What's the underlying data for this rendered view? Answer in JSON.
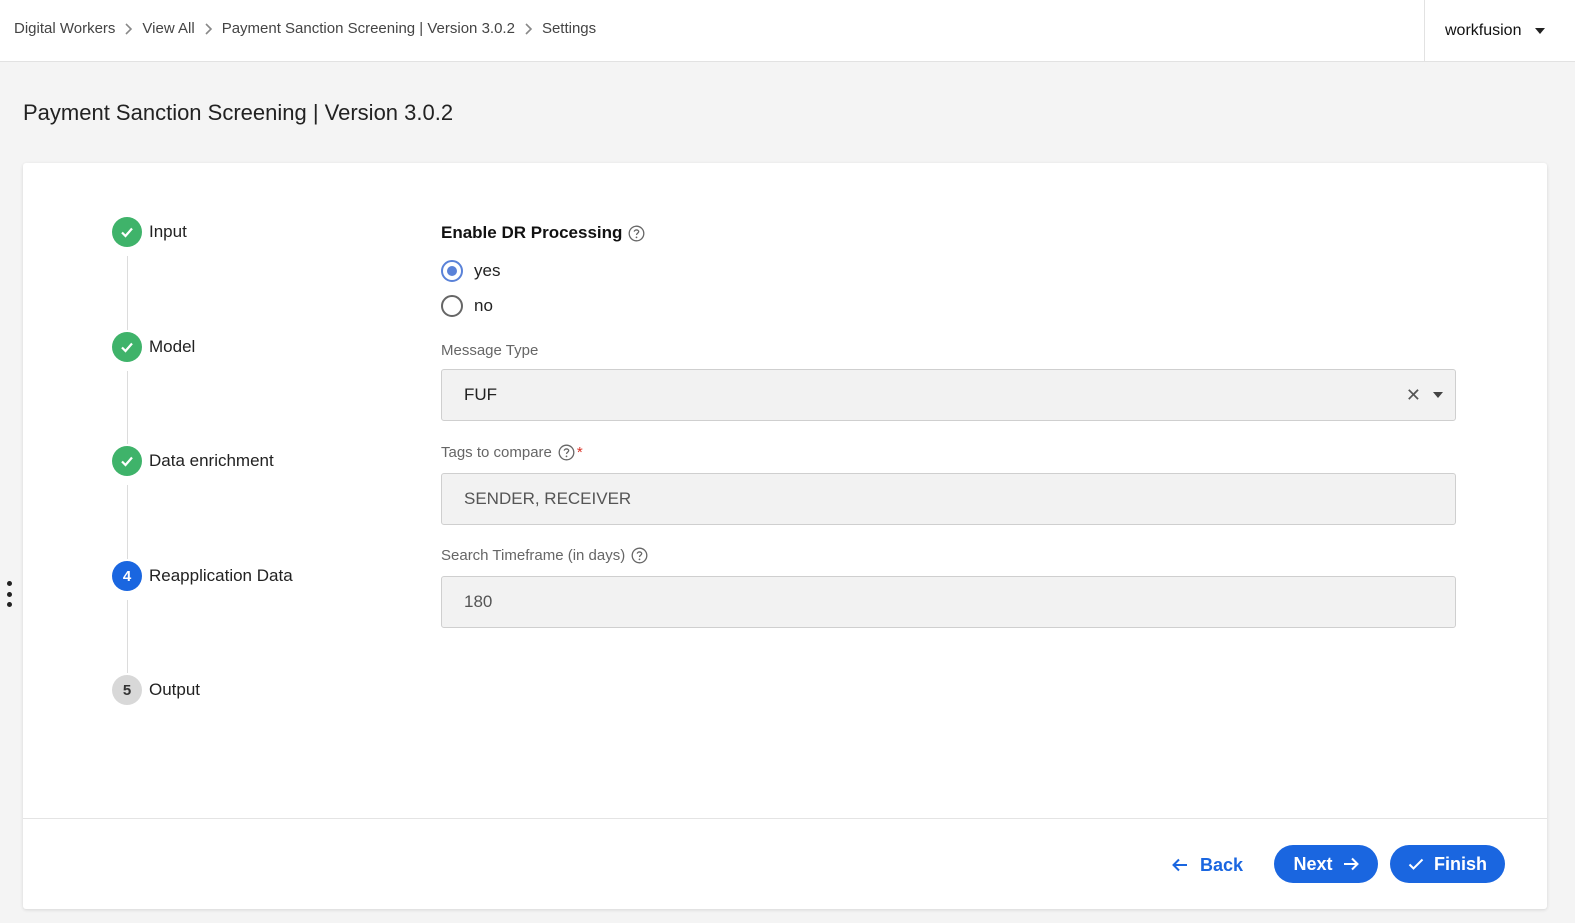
{
  "breadcrumb": {
    "items": [
      "Digital Workers",
      "View All",
      "Payment Sanction Screening | Version 3.0.2",
      "Settings"
    ]
  },
  "tenant": {
    "name": "workfusion"
  },
  "page": {
    "title": "Payment Sanction Screening | Version 3.0.2"
  },
  "stepper": {
    "steps": [
      {
        "label": "Input",
        "status": "done",
        "badge": ""
      },
      {
        "label": "Model",
        "status": "done",
        "badge": ""
      },
      {
        "label": "Data enrichment",
        "status": "done",
        "badge": ""
      },
      {
        "label": "Reapplication Data",
        "status": "active",
        "badge": "4"
      },
      {
        "label": "Output",
        "status": "pending",
        "badge": "5"
      }
    ]
  },
  "form": {
    "dr_processing": {
      "title": "Enable DR Processing",
      "options": [
        {
          "label": "yes",
          "checked": true
        },
        {
          "label": "no",
          "checked": false
        }
      ]
    },
    "message_type": {
      "label": "Message Type",
      "value": "FUF",
      "clear": "✕"
    },
    "tags": {
      "label": "Tags to compare",
      "required_mark": "*",
      "value": "SENDER, RECEIVER"
    },
    "timeframe": {
      "label": "Search Timeframe (in days)",
      "value": "180"
    }
  },
  "footer": {
    "back_label": "Back",
    "next_label": "Next",
    "finish_label": "Finish"
  },
  "colors": {
    "primary": "#1a66e0",
    "done": "#3fb36a",
    "pending": "#d8d8d8",
    "radio_selected": "#5a82d8"
  }
}
